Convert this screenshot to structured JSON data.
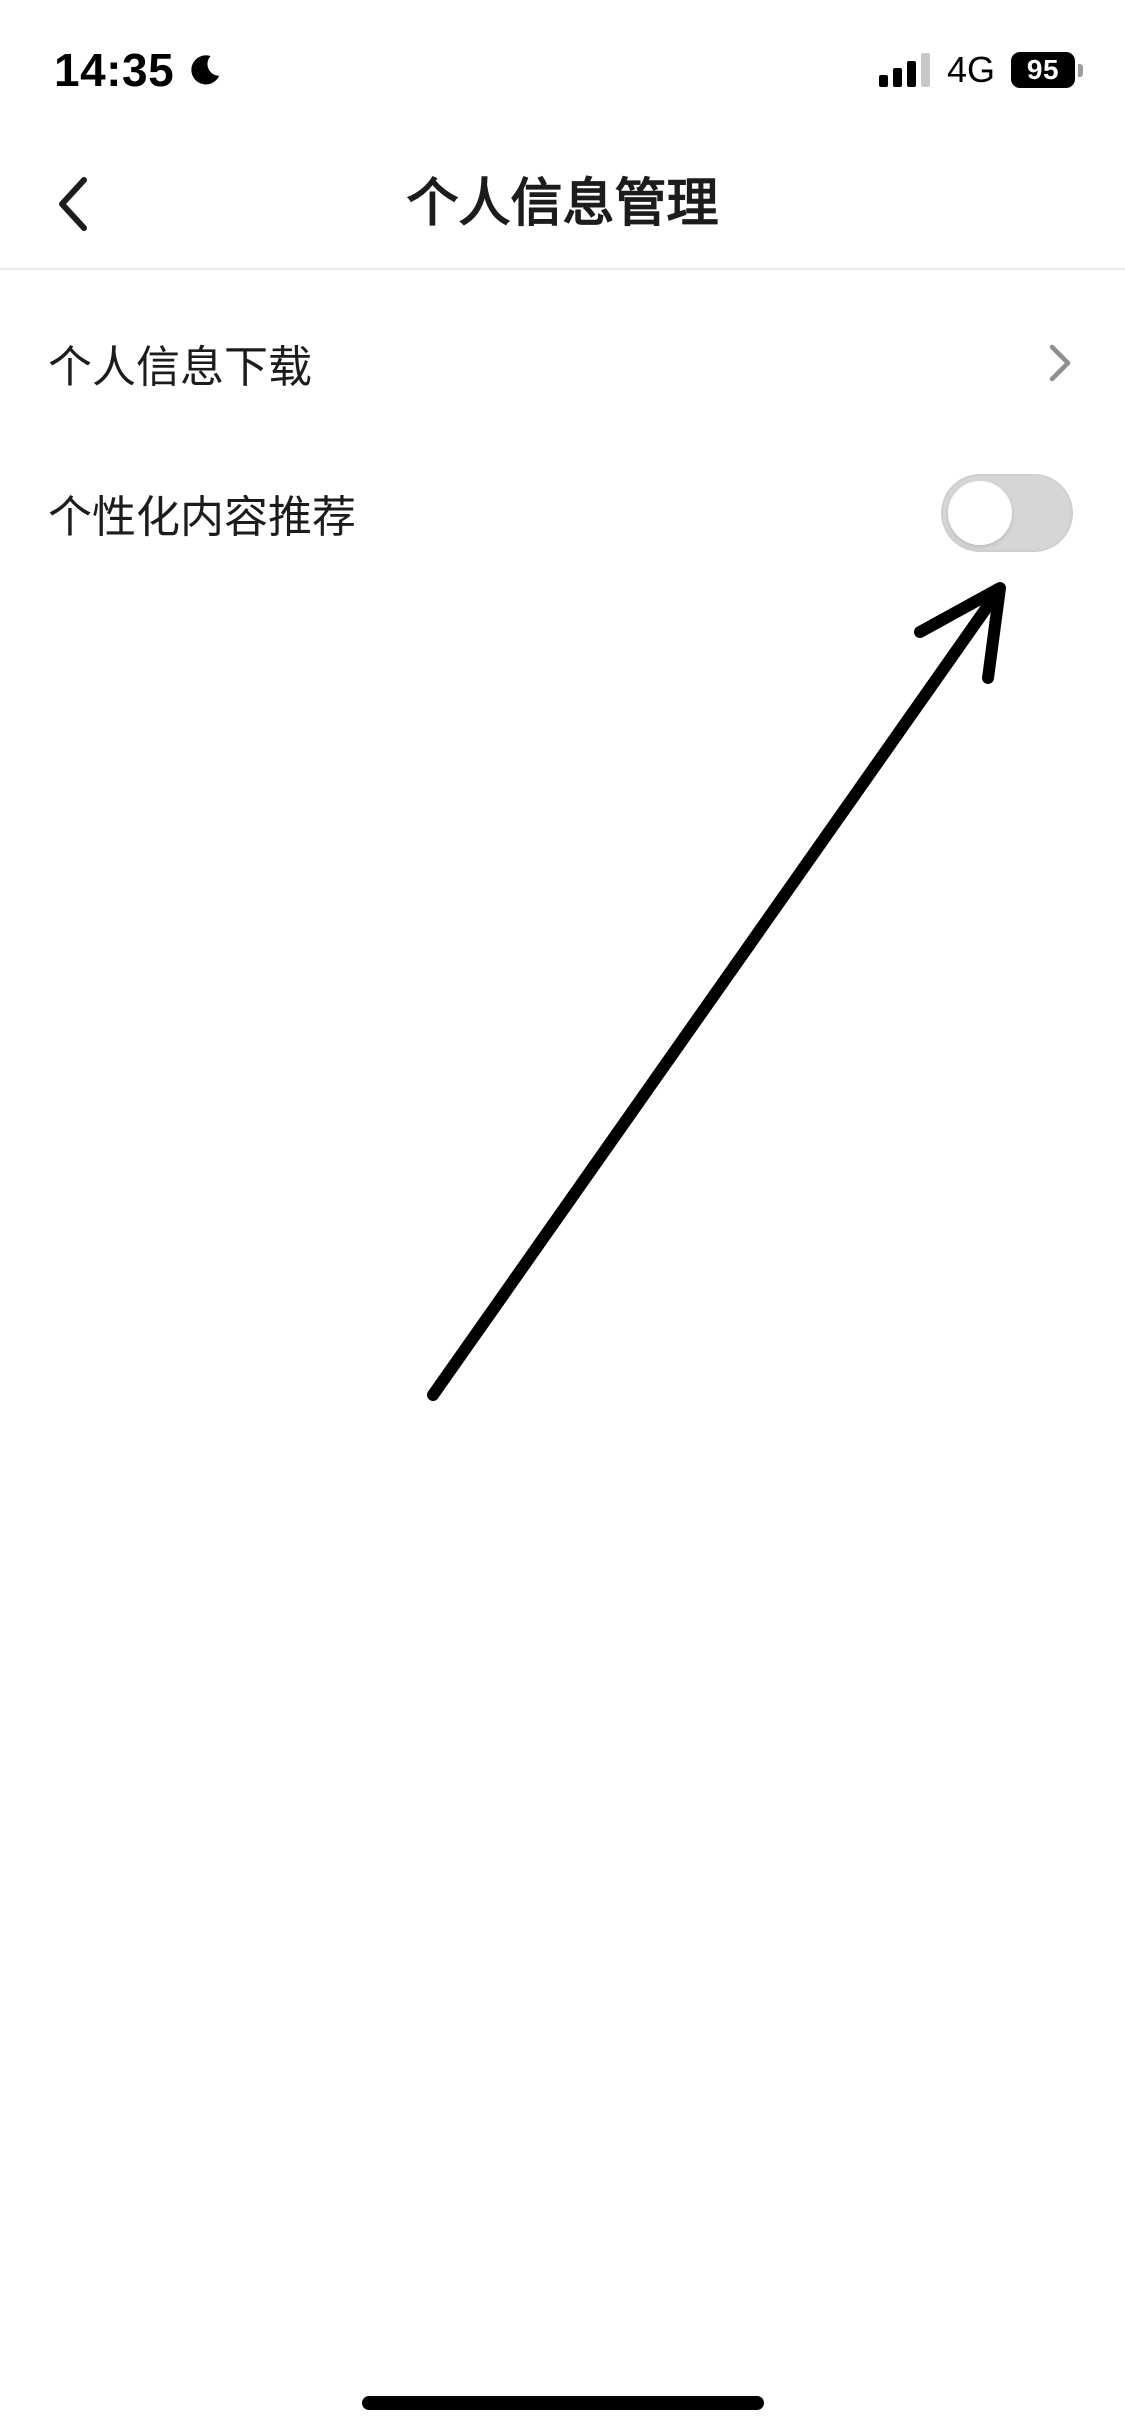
{
  "status_bar": {
    "time": "14:35",
    "network": "4G",
    "battery_level": "95",
    "icons": [
      "moon-icon",
      "signal-icon",
      "battery-icon"
    ]
  },
  "nav": {
    "title": "个人信息管理",
    "back_icon": "chevron-left-icon"
  },
  "settings": {
    "items": [
      {
        "label": "个人信息下载",
        "control": "chevron-right-icon"
      },
      {
        "label": "个性化内容推荐",
        "control": "toggle",
        "toggle_on": false
      }
    ]
  },
  "colors": {
    "toggle_off_track": "#d6d6d8",
    "divider": "#ececec",
    "chevron": "#8e8e93",
    "annotation_arrow": "#000000"
  }
}
